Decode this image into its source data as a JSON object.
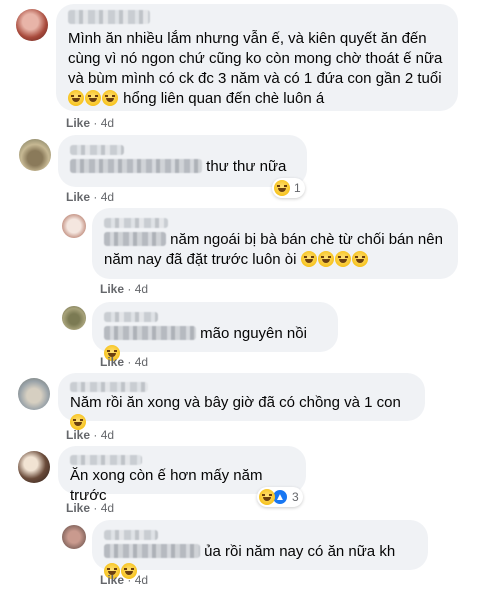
{
  "comments": [
    {
      "text": "Mình ăn nhiều lắm nhưng vẫn ế, và kiên quyết ăn đến cùng vì nó ngon chứ cũng ko còn mong chờ thoát ế nữa và bùm mình có ck đc 3 năm và có 1 đứa con gần 2 tuổi",
      "text_tail": "hổng liên quan đến chè luôn á",
      "like": "Like",
      "dot": "·",
      "time": "4d"
    },
    {
      "text": "thư thư nữa",
      "reaction_count": "1",
      "like": "Like",
      "dot": "·",
      "time": "4d"
    },
    {
      "text_line1": "năm ngoái bị bà bán chè từ chối bán nên",
      "text_line2": "năm nay đã đặt trước luôn òi",
      "like": "Like",
      "dot": "·",
      "time": "4d"
    },
    {
      "text": "mão nguyên nồi",
      "like": "Like",
      "dot": "·",
      "time": "4d"
    },
    {
      "text": "Năm rồi ăn xong và bây giờ đã có chồng và 1 con",
      "like": "Like",
      "dot": "·",
      "time": "4d"
    },
    {
      "text": "Ăn xong còn ế hơn mấy năm trước",
      "reaction_count": "3",
      "like": "Like",
      "dot": "·",
      "time": "4d"
    },
    {
      "text": "ủa rồi năm nay có ăn nữa kh",
      "like": "Like",
      "dot": "·",
      "time": "4d"
    }
  ],
  "colors": {
    "bubble": "#f0f2f5",
    "meta": "#65676b",
    "like_badge": "#1877f2"
  },
  "icons": [
    "laughing-emoji-icon",
    "like-badge-icon"
  ]
}
